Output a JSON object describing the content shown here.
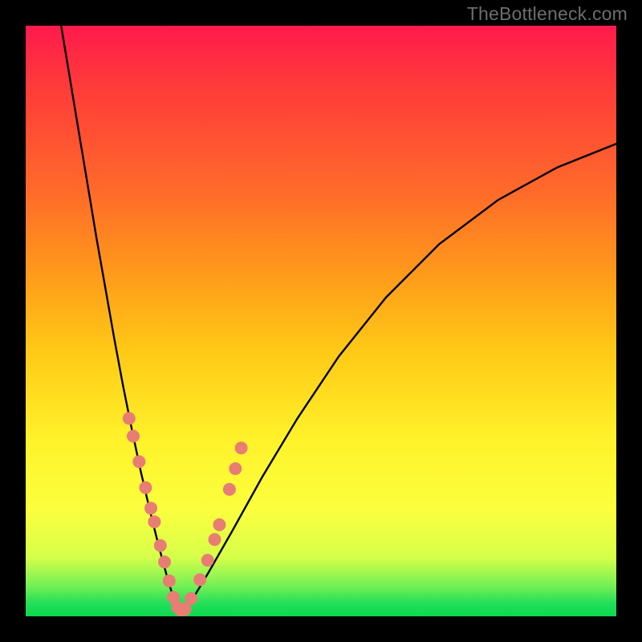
{
  "watermark": {
    "text": "TheBottleneck.com"
  },
  "chart_data": {
    "type": "line",
    "title": "",
    "xlabel": "",
    "ylabel": "",
    "xlim": [
      0,
      1
    ],
    "ylim": [
      0,
      1
    ],
    "series": [
      {
        "name": "left-curve",
        "x": [
          0.06,
          0.075,
          0.09,
          0.105,
          0.12,
          0.135,
          0.15,
          0.165,
          0.18,
          0.195,
          0.21,
          0.225,
          0.24,
          0.252,
          0.262
        ],
        "y": [
          1.0,
          0.91,
          0.82,
          0.73,
          0.64,
          0.555,
          0.47,
          0.39,
          0.315,
          0.245,
          0.18,
          0.12,
          0.065,
          0.025,
          0.0
        ]
      },
      {
        "name": "right-curve",
        "x": [
          0.262,
          0.28,
          0.31,
          0.35,
          0.4,
          0.46,
          0.53,
          0.61,
          0.7,
          0.8,
          0.9,
          1.0
        ],
        "y": [
          0.0,
          0.025,
          0.075,
          0.145,
          0.235,
          0.335,
          0.44,
          0.54,
          0.63,
          0.705,
          0.76,
          0.8
        ]
      }
    ],
    "markers": {
      "name": "dots",
      "color": "#e87d74",
      "x": [
        0.175,
        0.182,
        0.192,
        0.203,
        0.212,
        0.218,
        0.228,
        0.235,
        0.243,
        0.25,
        0.257,
        0.263,
        0.27,
        0.28,
        0.295,
        0.308,
        0.32,
        0.328,
        0.345,
        0.355,
        0.365
      ],
      "y": [
        0.335,
        0.305,
        0.262,
        0.218,
        0.183,
        0.16,
        0.12,
        0.092,
        0.06,
        0.032,
        0.015,
        0.01,
        0.012,
        0.03,
        0.062,
        0.095,
        0.13,
        0.155,
        0.215,
        0.25,
        0.285
      ]
    }
  }
}
